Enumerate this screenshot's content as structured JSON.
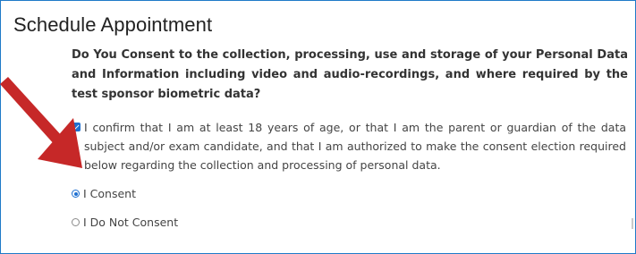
{
  "dialog": {
    "title": "Schedule Appointment"
  },
  "consent": {
    "question": "Do You Consent to the collection, processing, use and storage of your Personal Data and Information including video and audio-recordings, and where required by the test sponsor biometric data?",
    "confirm_text": "I confirm that I am at least 18 years of age, or that I am the parent or guardian of the data subject and/or exam candidate, and that I am authorized to make the consent election required below regarding the collection and processing of personal data.",
    "confirm_checked": true,
    "options": [
      {
        "label": "I Consent",
        "selected": true
      },
      {
        "label": "I Do Not Consent",
        "selected": false
      }
    ]
  },
  "annotation": {
    "arrow_color": "#c62828"
  },
  "colors": {
    "frame_border": "#1f7ac8",
    "control_accent": "#1e6fd0"
  }
}
